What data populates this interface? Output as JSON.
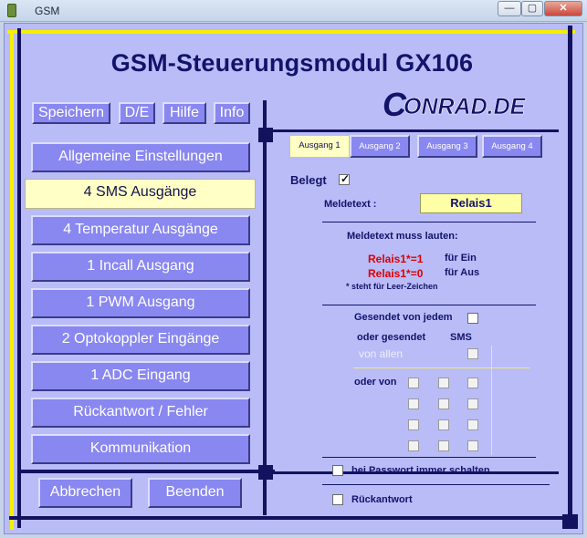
{
  "window": {
    "title": "GSM",
    "min": "—",
    "max": "▢",
    "close": "✕"
  },
  "app": {
    "title": "GSM-Steuerungsmodul  GX106"
  },
  "toolbar": {
    "save": "Speichern",
    "lang": "D/E",
    "help": "Hilfe",
    "info": "Info"
  },
  "logo": {
    "text": "ONRAD.DE",
    "initial": "C"
  },
  "menu": [
    {
      "label": "Allgemeine Einstellungen",
      "active": false
    },
    {
      "label": "4 SMS Ausgänge",
      "active": true
    },
    {
      "label": "4 Temperatur Ausgänge",
      "active": false
    },
    {
      "label": "1 Incall Ausgang",
      "active": false
    },
    {
      "label": "1 PWM Ausgang",
      "active": false
    },
    {
      "label": "2 Optokoppler Eingänge",
      "active": false
    },
    {
      "label": "1 ADC Eingang",
      "active": false
    },
    {
      "label": "Rückantwort / Fehler",
      "active": false
    },
    {
      "label": "Kommunikation",
      "active": false
    }
  ],
  "footer": {
    "cancel": "Abbrechen",
    "exit": "Beenden"
  },
  "tabs": [
    "Ausgang  1",
    "Ausgang  2",
    "Ausgang  3",
    "Ausgang  4"
  ],
  "panel": {
    "belegt_label": "Belegt",
    "meldetext_label": "Meldetext :",
    "meldetext_value": "Relais1",
    "muss_lauten": "Meldetext muss lauten:",
    "code_on": "Relais1*=1",
    "code_off": "Relais1*=0",
    "fuer_ein": "für Ein",
    "fuer_aus": "für Aus",
    "leer_hint": "* steht für Leer-Zeichen",
    "gesendet_jedem": "Gesendet von jedem",
    "oder_gesendet": "oder gesendet",
    "sms": "SMS",
    "von_allen": "von allen",
    "oder_von": "oder von",
    "passwort": "bei Passwort immer schalten",
    "rueckantwort": "Rückantwort"
  },
  "colors": {
    "background": "#b9bcf7",
    "button": "#8987f0",
    "title": "#13136a",
    "yellow": "#f6f000",
    "red": "#e00000"
  }
}
